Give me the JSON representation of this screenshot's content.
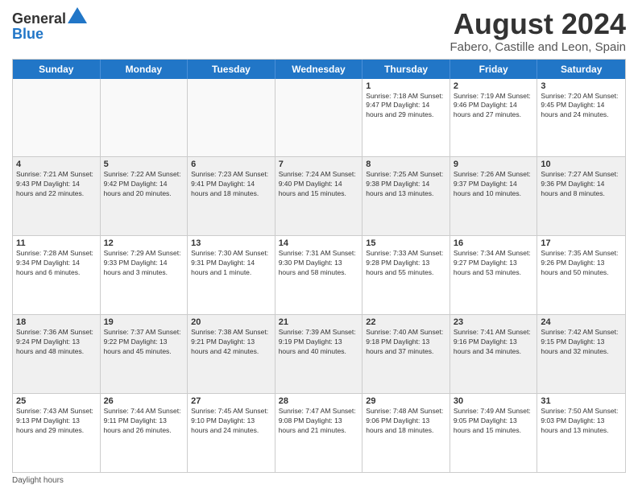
{
  "logo": {
    "general": "General",
    "blue": "Blue"
  },
  "title": "August 2024",
  "subtitle": "Fabero, Castille and Leon, Spain",
  "days_header": [
    "Sunday",
    "Monday",
    "Tuesday",
    "Wednesday",
    "Thursday",
    "Friday",
    "Saturday"
  ],
  "footer": "Daylight hours",
  "weeks": [
    [
      {
        "day": "",
        "info": "",
        "empty": true
      },
      {
        "day": "",
        "info": "",
        "empty": true
      },
      {
        "day": "",
        "info": "",
        "empty": true
      },
      {
        "day": "",
        "info": "",
        "empty": true
      },
      {
        "day": "1",
        "info": "Sunrise: 7:18 AM\nSunset: 9:47 PM\nDaylight: 14 hours\nand 29 minutes."
      },
      {
        "day": "2",
        "info": "Sunrise: 7:19 AM\nSunset: 9:46 PM\nDaylight: 14 hours\nand 27 minutes."
      },
      {
        "day": "3",
        "info": "Sunrise: 7:20 AM\nSunset: 9:45 PM\nDaylight: 14 hours\nand 24 minutes."
      }
    ],
    [
      {
        "day": "4",
        "info": "Sunrise: 7:21 AM\nSunset: 9:43 PM\nDaylight: 14 hours\nand 22 minutes."
      },
      {
        "day": "5",
        "info": "Sunrise: 7:22 AM\nSunset: 9:42 PM\nDaylight: 14 hours\nand 20 minutes."
      },
      {
        "day": "6",
        "info": "Sunrise: 7:23 AM\nSunset: 9:41 PM\nDaylight: 14 hours\nand 18 minutes."
      },
      {
        "day": "7",
        "info": "Sunrise: 7:24 AM\nSunset: 9:40 PM\nDaylight: 14 hours\nand 15 minutes."
      },
      {
        "day": "8",
        "info": "Sunrise: 7:25 AM\nSunset: 9:38 PM\nDaylight: 14 hours\nand 13 minutes."
      },
      {
        "day": "9",
        "info": "Sunrise: 7:26 AM\nSunset: 9:37 PM\nDaylight: 14 hours\nand 10 minutes."
      },
      {
        "day": "10",
        "info": "Sunrise: 7:27 AM\nSunset: 9:36 PM\nDaylight: 14 hours\nand 8 minutes."
      }
    ],
    [
      {
        "day": "11",
        "info": "Sunrise: 7:28 AM\nSunset: 9:34 PM\nDaylight: 14 hours\nand 6 minutes."
      },
      {
        "day": "12",
        "info": "Sunrise: 7:29 AM\nSunset: 9:33 PM\nDaylight: 14 hours\nand 3 minutes."
      },
      {
        "day": "13",
        "info": "Sunrise: 7:30 AM\nSunset: 9:31 PM\nDaylight: 14 hours\nand 1 minute."
      },
      {
        "day": "14",
        "info": "Sunrise: 7:31 AM\nSunset: 9:30 PM\nDaylight: 13 hours\nand 58 minutes."
      },
      {
        "day": "15",
        "info": "Sunrise: 7:33 AM\nSunset: 9:28 PM\nDaylight: 13 hours\nand 55 minutes."
      },
      {
        "day": "16",
        "info": "Sunrise: 7:34 AM\nSunset: 9:27 PM\nDaylight: 13 hours\nand 53 minutes."
      },
      {
        "day": "17",
        "info": "Sunrise: 7:35 AM\nSunset: 9:26 PM\nDaylight: 13 hours\nand 50 minutes."
      }
    ],
    [
      {
        "day": "18",
        "info": "Sunrise: 7:36 AM\nSunset: 9:24 PM\nDaylight: 13 hours\nand 48 minutes."
      },
      {
        "day": "19",
        "info": "Sunrise: 7:37 AM\nSunset: 9:22 PM\nDaylight: 13 hours\nand 45 minutes."
      },
      {
        "day": "20",
        "info": "Sunrise: 7:38 AM\nSunset: 9:21 PM\nDaylight: 13 hours\nand 42 minutes."
      },
      {
        "day": "21",
        "info": "Sunrise: 7:39 AM\nSunset: 9:19 PM\nDaylight: 13 hours\nand 40 minutes."
      },
      {
        "day": "22",
        "info": "Sunrise: 7:40 AM\nSunset: 9:18 PM\nDaylight: 13 hours\nand 37 minutes."
      },
      {
        "day": "23",
        "info": "Sunrise: 7:41 AM\nSunset: 9:16 PM\nDaylight: 13 hours\nand 34 minutes."
      },
      {
        "day": "24",
        "info": "Sunrise: 7:42 AM\nSunset: 9:15 PM\nDaylight: 13 hours\nand 32 minutes."
      }
    ],
    [
      {
        "day": "25",
        "info": "Sunrise: 7:43 AM\nSunset: 9:13 PM\nDaylight: 13 hours\nand 29 minutes."
      },
      {
        "day": "26",
        "info": "Sunrise: 7:44 AM\nSunset: 9:11 PM\nDaylight: 13 hours\nand 26 minutes."
      },
      {
        "day": "27",
        "info": "Sunrise: 7:45 AM\nSunset: 9:10 PM\nDaylight: 13 hours\nand 24 minutes."
      },
      {
        "day": "28",
        "info": "Sunrise: 7:47 AM\nSunset: 9:08 PM\nDaylight: 13 hours\nand 21 minutes."
      },
      {
        "day": "29",
        "info": "Sunrise: 7:48 AM\nSunset: 9:06 PM\nDaylight: 13 hours\nand 18 minutes."
      },
      {
        "day": "30",
        "info": "Sunrise: 7:49 AM\nSunset: 9:05 PM\nDaylight: 13 hours\nand 15 minutes."
      },
      {
        "day": "31",
        "info": "Sunrise: 7:50 AM\nSunset: 9:03 PM\nDaylight: 13 hours\nand 13 minutes."
      }
    ]
  ]
}
